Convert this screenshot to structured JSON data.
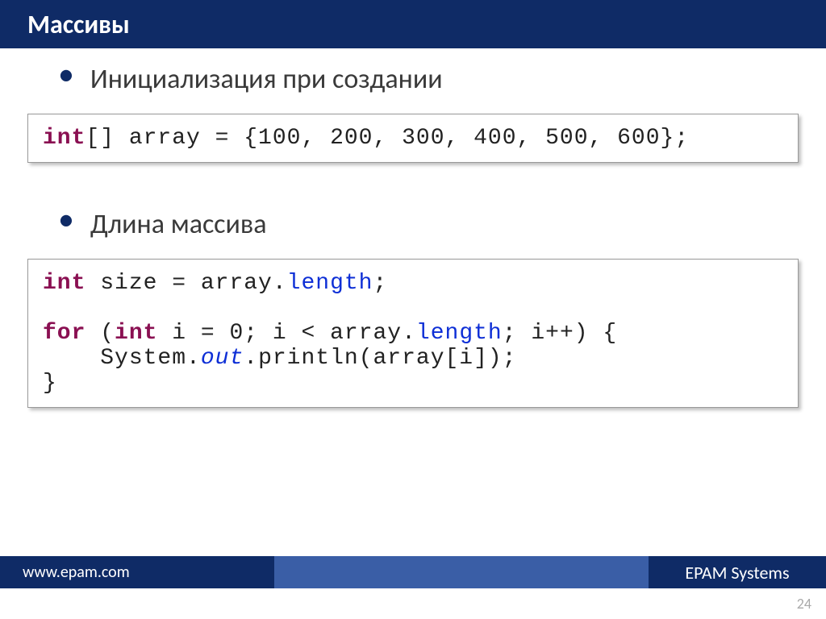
{
  "header": {
    "title": "Массивы"
  },
  "bullets": [
    "Инициализация при создании",
    "Длина массива"
  ],
  "code1": {
    "kw_int": "int",
    "line1_rest": "[] array = {100, 200, 300, 400, 500, 600};"
  },
  "code2": {
    "kw_int1": "int",
    "l1_a": " size = array.",
    "mem_length1": "length",
    "l1_b": ";",
    "blank": "",
    "kw_for": "for",
    "l3_a": " (",
    "kw_int2": "int",
    "l3_b": " i = 0; i < array.",
    "mem_length2": "length",
    "l3_c": "; i++) {",
    "l4_a": "    System.",
    "mem_out": "out",
    "l4_b": ".println(array[i]);",
    "l5": "}"
  },
  "footer": {
    "url": "www.epam.com",
    "company": "EPAM Systems"
  },
  "page_number": "24"
}
